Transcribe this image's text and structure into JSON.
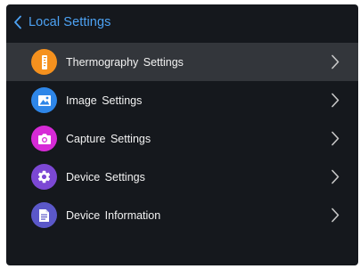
{
  "header": {
    "back_icon": "chevron-left-icon",
    "title": "Local Settings"
  },
  "colors": {
    "background": "#15181d",
    "selected_row": "#33363b",
    "title": "#4da3f5",
    "label": "#f2f2f2",
    "chevron": "#c8c8c8"
  },
  "menu": {
    "items": [
      {
        "label": "Thermography Settings",
        "icon": "thermometer-icon",
        "color": "#f5911e",
        "selected": true
      },
      {
        "label": "Image Settings",
        "icon": "image-icon",
        "color": "#2e86e8",
        "selected": false
      },
      {
        "label": "Capture Settings",
        "icon": "camera-icon",
        "color": "#d62ad6",
        "selected": false
      },
      {
        "label": "Device Settings",
        "icon": "gear-icon",
        "color": "#7c48d4",
        "selected": false
      },
      {
        "label": "Device Information",
        "icon": "document-icon",
        "color": "#5b58c9",
        "selected": false
      }
    ]
  }
}
